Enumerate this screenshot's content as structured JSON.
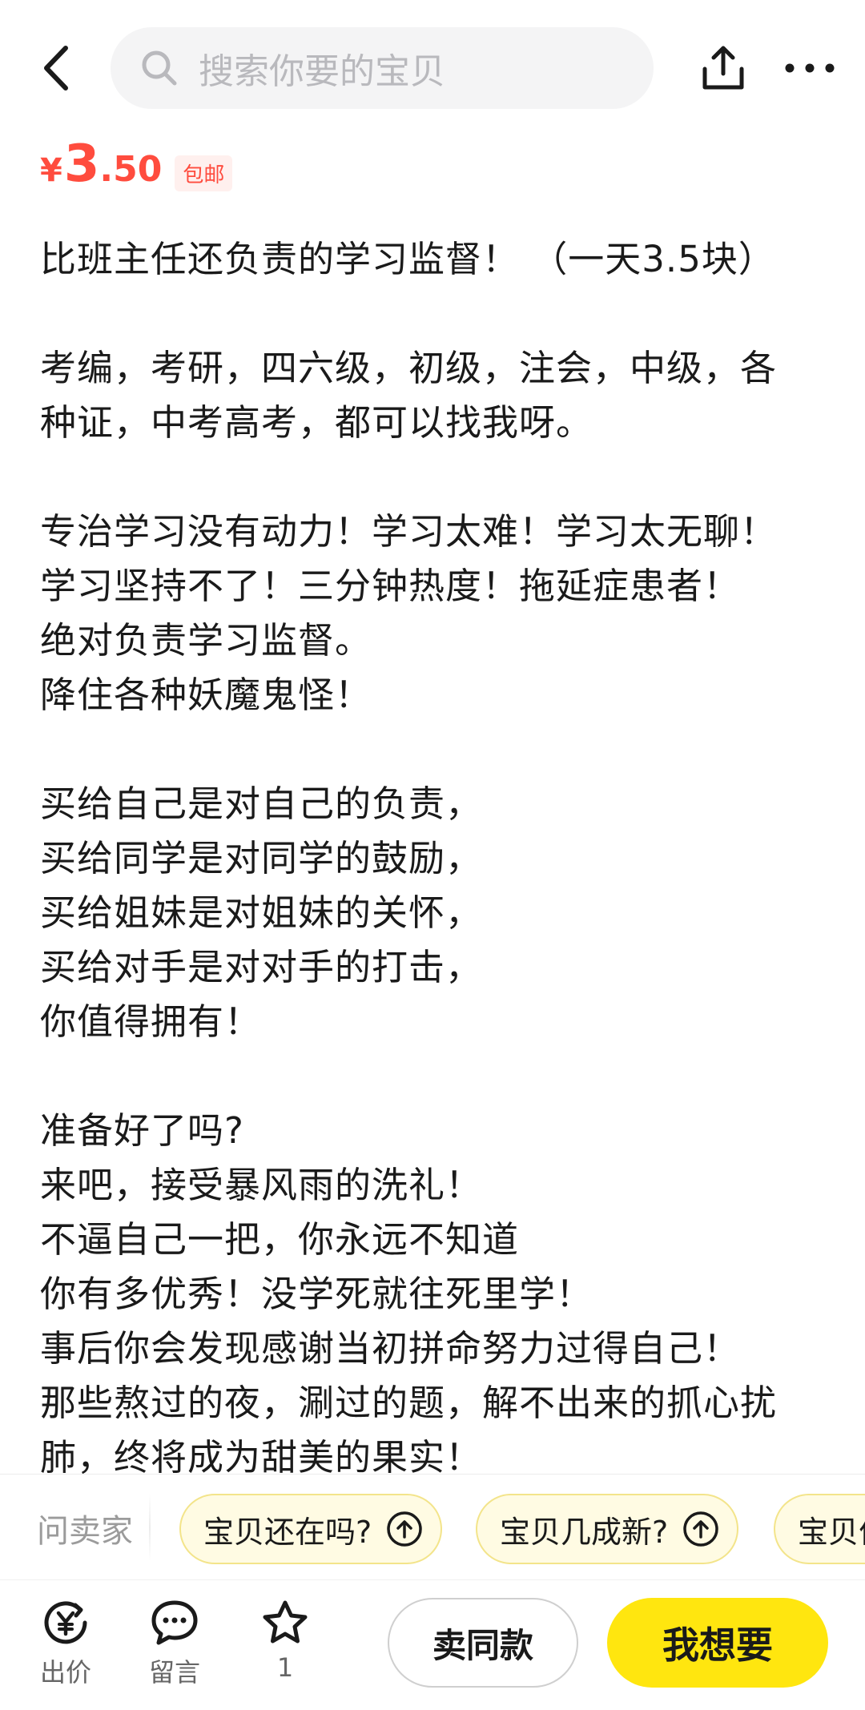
{
  "header": {
    "search_placeholder": "搜索你要的宝贝",
    "icons": {
      "back": "chevron-left-icon",
      "search": "search-icon",
      "share": "share-icon",
      "more": "more-dots-icon"
    }
  },
  "price": {
    "symbol": "¥",
    "integer": "3",
    "decimal": ".50",
    "badge": "包邮",
    "color": "#ff4c3e"
  },
  "description": {
    "lines": [
      "比班主任还负责的学习监督！  （一天3.5块）",
      "",
      "考编，考研，四六级，初级，注会，中级，各",
      "种证，中考高考，都可以找我呀。",
      "",
      "专治学习没有动力！学习太难！学习太无聊！",
      "学习坚持不了！三分钟热度！拖延症患者！",
      "绝对负责学习监督。",
      "降住各种妖魔鬼怪！",
      "",
      "买给自己是对自己的负责，",
      "买给同学是对同学的鼓励，",
      "买给姐妹是对姐妹的关怀，",
      "买给对手是对对手的打击，",
      "你值得拥有！",
      "",
      "准备好了吗?",
      "来吧，接受暴风雨的洗礼！",
      "不逼自己一把，你永远不知道",
      "你有多优秀！没学死就往死里学！",
      "事后你会发现感谢当初拼命努力过得自己！",
      "那些熬过的夜，涮过的题，解不出来的抓心扰",
      "肺，终将成为甜美的果实！"
    ]
  },
  "ask_seller": {
    "label": "问卖家",
    "chips": [
      "宝贝还在吗?",
      "宝贝几成新?",
      "宝贝价"
    ]
  },
  "bottom_bar": {
    "offer_label": "出价",
    "comment_label": "留言",
    "favorite_count": "1",
    "sell_same_label": "卖同款",
    "want_label": "我想要",
    "accent_color": "#ffe60f"
  }
}
